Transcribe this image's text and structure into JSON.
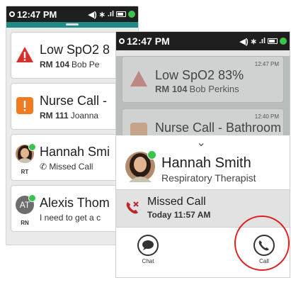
{
  "colors": {
    "alert_red": "#d9302b",
    "nurse_orange": "#f07b22",
    "teal": "#1f8a86",
    "online_green": "#3bc44b",
    "call_red": "#c0272d",
    "highlight_ring": "#e02020"
  },
  "back_phone": {
    "status": {
      "time": "12:47 PM"
    },
    "messages": [
      {
        "title": "Low SpO2 8",
        "room": "RM 104",
        "person": "Bob Pe",
        "icon": "warning-triangle-icon"
      },
      {
        "title": "Nurse Call -",
        "room": "RM 111",
        "person": "Joanna",
        "icon": "exclamation-square-icon"
      },
      {
        "title": "Hannah Smi",
        "sub": "Missed Call",
        "role": "RT",
        "icon": "avatar"
      },
      {
        "title": "Alexis Thom",
        "sub": "I need to get a c",
        "role": "RN",
        "initials": "AT"
      }
    ]
  },
  "front_phone": {
    "status": {
      "time": "12:47 PM"
    },
    "messages": [
      {
        "title": "Low SpO2 83%",
        "room": "RM 104",
        "person": "Bob Perkins",
        "time": "12:47 PM"
      },
      {
        "title": "Nurse Call - Bathroom",
        "time": "12:40 PM"
      }
    ],
    "contact": {
      "name": "Hannah Smith",
      "role": "Respiratory Therapist"
    },
    "missed_call": {
      "label": "Missed Call",
      "when": "Today 11:57 AM"
    },
    "actions": {
      "chat": "Chat",
      "call": "Call"
    }
  }
}
